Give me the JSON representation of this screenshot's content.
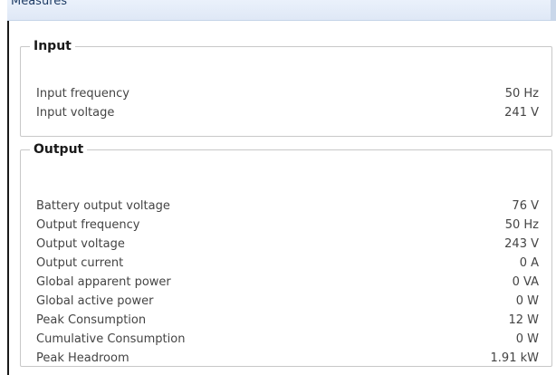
{
  "panel": {
    "title": "Measures"
  },
  "input_section": {
    "legend": "Input",
    "rows": [
      {
        "label": "Input frequency",
        "value": "50 Hz"
      },
      {
        "label": "Input voltage",
        "value": "241 V"
      }
    ]
  },
  "output_section": {
    "legend": "Output",
    "rows": [
      {
        "label": "Battery output voltage",
        "value": "76 V"
      },
      {
        "label": "Output frequency",
        "value": "50 Hz"
      },
      {
        "label": "Output voltage",
        "value": "243 V"
      },
      {
        "label": "Output current",
        "value": "0 A"
      },
      {
        "label": "Global apparent power",
        "value": "0 VA"
      },
      {
        "label": "Global active power",
        "value": "0 W"
      },
      {
        "label": "Peak Consumption",
        "value": "12 W"
      },
      {
        "label": "Cumulative Consumption",
        "value": "0 W"
      },
      {
        "label": "Peak Headroom",
        "value": "1.91 kW"
      }
    ]
  }
}
